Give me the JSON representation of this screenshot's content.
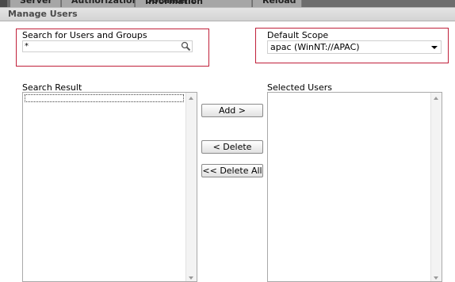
{
  "tabs": [
    "Server",
    "Authorization",
    "Document Information",
    "Reload"
  ],
  "window": {
    "title": "Manage Users"
  },
  "search": {
    "label": "Search for Users and Groups",
    "value": "*",
    "icon": "magnifier-icon"
  },
  "scope": {
    "label": "Default Scope",
    "selected": "apac (WinNT://APAC)"
  },
  "results": {
    "label": "Search Result",
    "items": []
  },
  "selected": {
    "label": "Selected Users",
    "items": []
  },
  "buttons": {
    "add": "Add >",
    "delete": "< Delete",
    "delete_all": "<< Delete All"
  },
  "colors": {
    "highlight_box": "#c0203a",
    "titlebar": "#d8d8d8",
    "tabstrip": "#6e6e6e"
  }
}
